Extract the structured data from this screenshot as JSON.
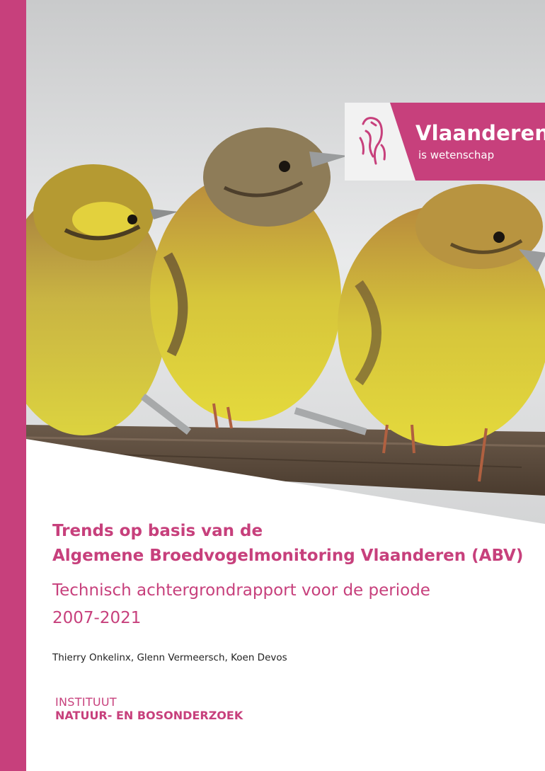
{
  "cover": {
    "colors": {
      "accent": "#c7407c",
      "text": "#222222",
      "background": "#ffffff"
    },
    "photo": {
      "description": "three yellowhammers perched on a wooden branch",
      "icon": "bird-photo"
    },
    "brand": {
      "name": "Vlaanderen",
      "tagline": "is wetenschap",
      "icon": "flemish-lion-icon"
    },
    "title_line1": "Trends op basis van de",
    "title_line2": "Algemene Broedvogelmonitoring Vlaanderen (ABV)",
    "subtitle_line1": "Technisch achtergrondrapport voor de periode",
    "subtitle_line2": "2007-2021",
    "authors": "Thierry Onkelinx, Glenn Vermeersch, Koen Devos",
    "institute_line1": "INSTITUUT",
    "institute_line2": "NATUUR- EN BOSONDERZOEK"
  }
}
